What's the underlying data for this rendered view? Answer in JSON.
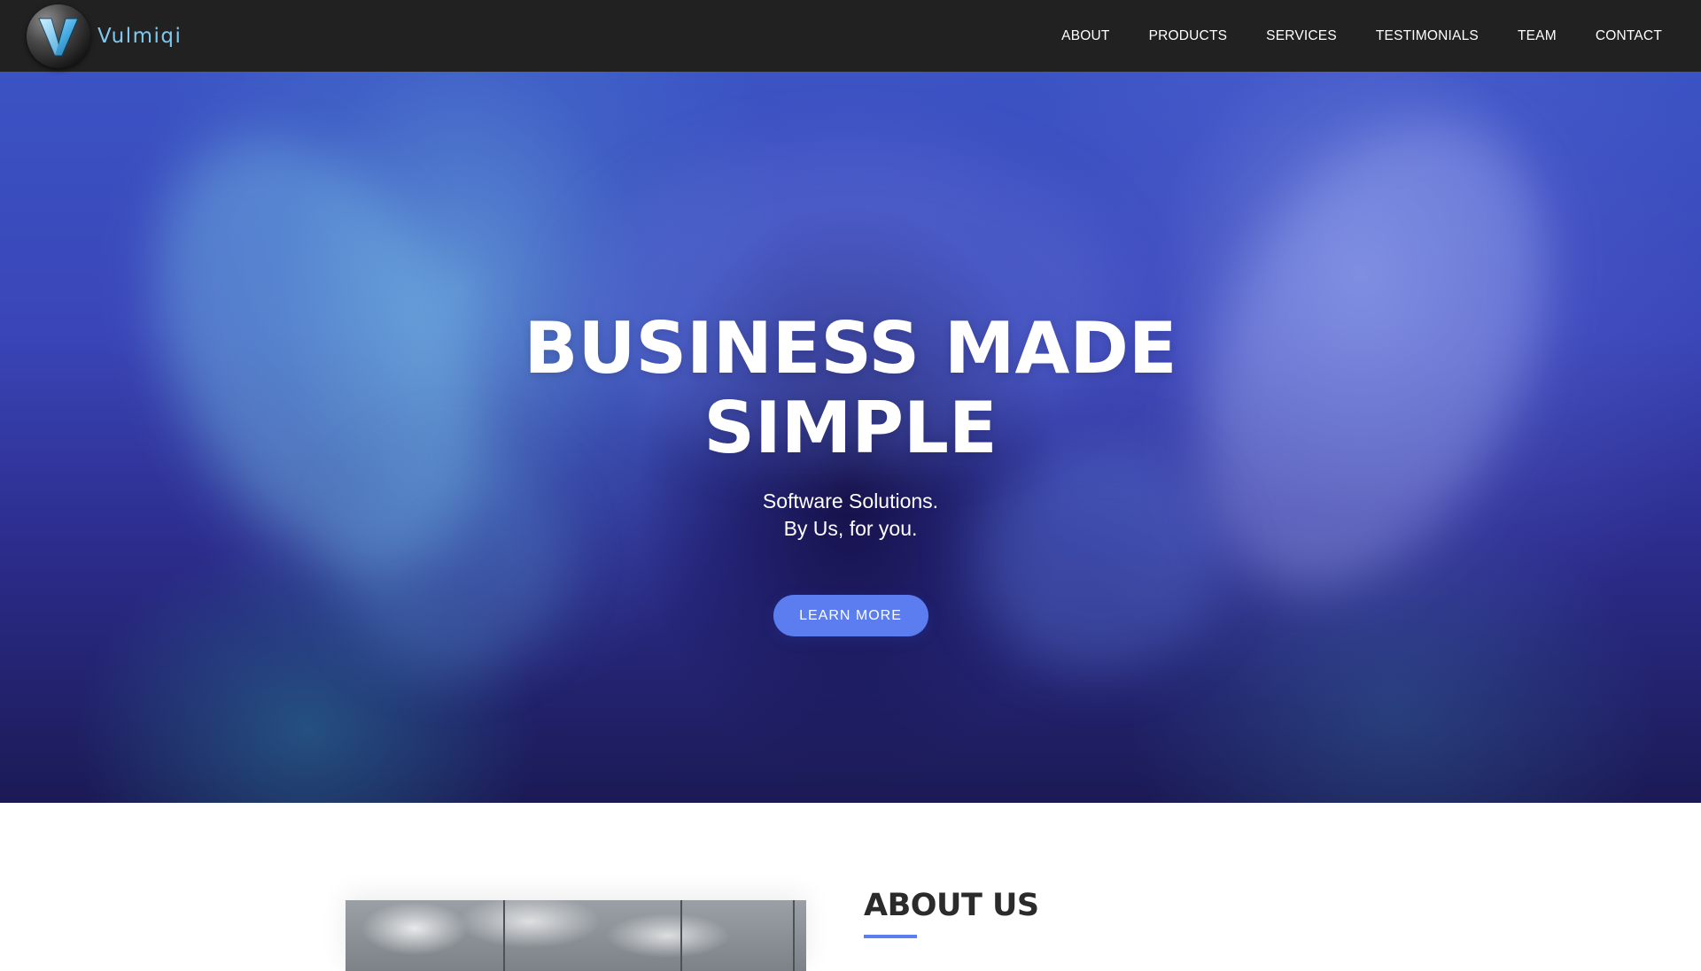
{
  "brand": {
    "name": "Vulmiqi",
    "logo_icon": "v-letter-logo-icon"
  },
  "nav": {
    "items": [
      {
        "label": "ABOUT"
      },
      {
        "label": "PRODUCTS"
      },
      {
        "label": "SERVICES"
      },
      {
        "label": "TESTIMONIALS"
      },
      {
        "label": "TEAM"
      },
      {
        "label": "CONTACT"
      }
    ]
  },
  "hero": {
    "title_line1": "BUSINESS MADE",
    "title_line2": "SIMPLE",
    "subtitle_line1": "Software Solutions.",
    "subtitle_line2": "By Us, for you.",
    "cta_label": "LEARN MORE"
  },
  "about": {
    "title": "ABOUT US"
  },
  "colors": {
    "navbar_bg": "#212121",
    "brand_text": "#7ec9f0",
    "accent": "#5b7df0",
    "heading_dark": "#2b2b2b"
  }
}
